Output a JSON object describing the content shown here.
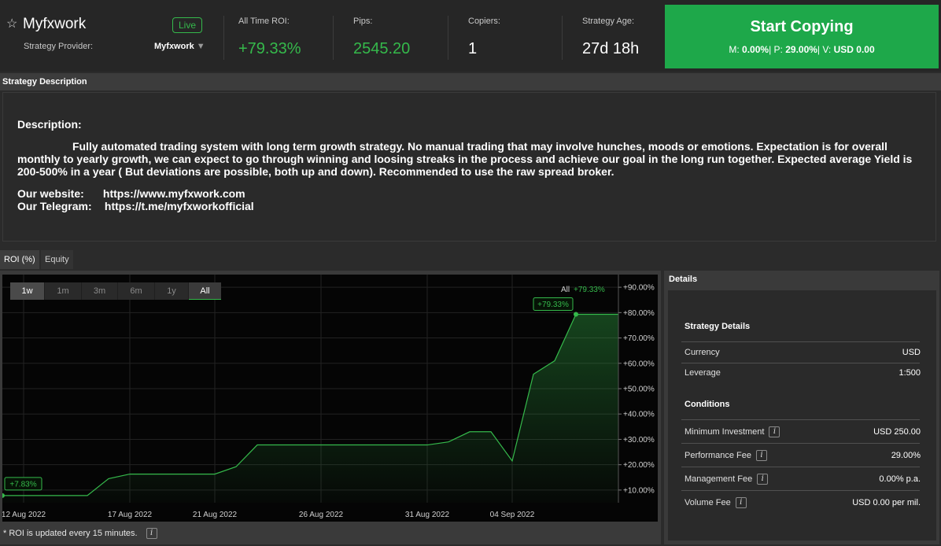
{
  "header": {
    "star_icon": "star-outline-icon",
    "strategy_name": "Myfxwork",
    "live_badge": "Live",
    "provider_label": "Strategy Provider:",
    "provider_value": "Myfxwork",
    "provider_caret": "▼",
    "stats": [
      {
        "label": "All Time ROI:",
        "value": "+79.33%"
      },
      {
        "label": "Pips:",
        "value": "2545.20"
      },
      {
        "label": "Copiers:",
        "value": "1"
      },
      {
        "label": "Strategy Age:",
        "value": "27d 18h"
      }
    ],
    "start_copying": {
      "title": "Start Copying",
      "m_label": "M:",
      "m_value": "0.00%",
      "p_label": "| P:",
      "p_value": "29.00%",
      "v_label": "| V:",
      "v_value": "USD 0.00"
    }
  },
  "description": {
    "section_title": "Strategy Description",
    "heading": "Description:",
    "text": "Fully automated trading system with long term growth strategy. No manual trading that may involve hunches, moods or emotions. Expectation is for overall monthly to yearly growth, we can expect to go through winning and loosing streaks in the process and achieve our goal in the long run together. Expected average Yield is 200-500% in a year ( But deviations are possible, both up and down). Recommended to use the raw spread broker.",
    "website_label": "Our website:",
    "website_url": "https://www.myfxwork.com",
    "telegram_label": "Our Telegram:",
    "telegram_url": "https://t.me/myfxworkofficial"
  },
  "tabs": [
    {
      "label": "ROI (%)",
      "active": true
    },
    {
      "label": "Equity",
      "active": false
    }
  ],
  "chart": {
    "range_buttons": [
      "1w",
      "1m",
      "3m",
      "6m",
      "1y",
      "All"
    ],
    "selected_range": "All",
    "legend_name": "All",
    "legend_value": "+79.33%",
    "start_label": "+7.83%",
    "end_label": "+79.33%",
    "note": "* ROI is updated every 15 minutes.",
    "info_icon": "info-icon"
  },
  "chart_data": {
    "type": "area",
    "x": [
      "11 Aug 2022",
      "12 Aug 2022",
      "13 Aug 2022",
      "14 Aug 2022",
      "15 Aug 2022",
      "16 Aug 2022",
      "17 Aug 2022",
      "18 Aug 2022",
      "19 Aug 2022",
      "20 Aug 2022",
      "21 Aug 2022",
      "22 Aug 2022",
      "23 Aug 2022",
      "24 Aug 2022",
      "25 Aug 2022",
      "26 Aug 2022",
      "27 Aug 2022",
      "28 Aug 2022",
      "29 Aug 2022",
      "30 Aug 2022",
      "31 Aug 2022",
      "01 Sep 2022",
      "02 Sep 2022",
      "03 Sep 2022",
      "04 Sep 2022",
      "05 Sep 2022",
      "06 Sep 2022",
      "07 Sep 2022",
      "08 Sep 2022",
      "09 Sep 2022"
    ],
    "x_ticks": [
      "12 Aug 2022",
      "17 Aug 2022",
      "21 Aug 2022",
      "26 Aug 2022",
      "31 Aug 2022",
      "04 Sep 2022"
    ],
    "series": [
      {
        "name": "All",
        "values": [
          7.83,
          7.83,
          7.83,
          7.83,
          7.83,
          14.5,
          16.3,
          16.3,
          16.3,
          16.3,
          16.3,
          19.2,
          27.8,
          27.8,
          27.8,
          27.8,
          27.8,
          27.8,
          27.8,
          27.8,
          27.8,
          29.0,
          33.0,
          33.0,
          21.5,
          55.7,
          61.0,
          79.33,
          79.33,
          79.33
        ]
      }
    ],
    "y_ticks": [
      "+10.00%",
      "+20.00%",
      "+30.00%",
      "+40.00%",
      "+50.00%",
      "+60.00%",
      "+70.00%",
      "+80.00%",
      "+90.00%"
    ],
    "ylim": [
      5,
      95
    ],
    "grid": true,
    "line_color": "#35b94b"
  },
  "details": {
    "title": "Details",
    "strategy_details_heading": "Strategy Details",
    "rows": [
      {
        "label": "Currency",
        "value": "USD"
      },
      {
        "label": "Leverage",
        "value": "1:500"
      }
    ],
    "conditions_heading": "Conditions",
    "conditions": [
      {
        "label": "Minimum Investment",
        "value": "USD 250.00"
      },
      {
        "label": "Performance Fee",
        "value": "29.00%"
      },
      {
        "label": "Management Fee",
        "value": "0.00% p.a."
      },
      {
        "label": "Volume Fee",
        "value": "USD 0.00 per mil."
      }
    ]
  }
}
